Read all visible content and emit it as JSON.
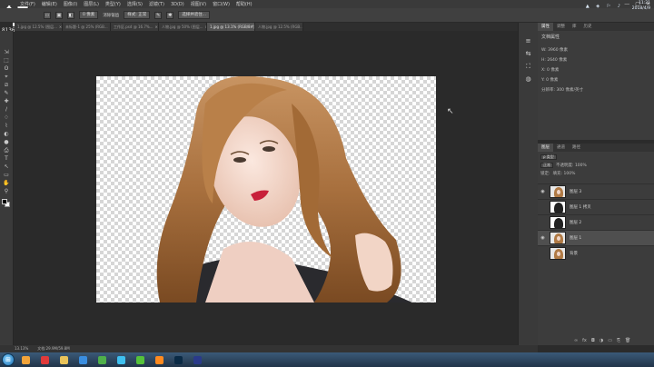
{
  "menu": [
    "文件(F)",
    "编辑(E)",
    "图像(I)",
    "图层(L)",
    "类型(Y)",
    "选择(S)",
    "滤镜(T)",
    "3D(D)",
    "视图(V)",
    "窗口(W)",
    "帮助(H)"
  ],
  "window_controls": [
    "—",
    "▢",
    "✕"
  ],
  "options": {
    "field1": "0 像素",
    "field2": "选择并遮住...",
    "check": "消除锯齿",
    "style": "样式: 正常"
  },
  "tabs": [
    {
      "label": "1.jpg @ 12.5% (图层...",
      "active": false
    },
    {
      "label": "未标题-1 @ 25% (RGB...",
      "active": false
    },
    {
      "label": "工作区.psd @ 16.7%...",
      "active": false
    },
    {
      "label": "人物.jpg @ 50% (图层...",
      "active": false
    },
    {
      "label": "1.jpg @ 13.1% (RGB/8#)",
      "active": true
    },
    {
      "label": "人物.jpg @ 12.5% (RGB...",
      "active": false
    }
  ],
  "watermark": {
    "logo": "今日",
    "sub": "头条号",
    "number": "8136828"
  },
  "tools": [
    "⇲",
    "⬚",
    "ʘ",
    "⌖",
    "⧄",
    "✎",
    "✚",
    "∕",
    "♢",
    "⌇",
    "◐",
    "●",
    "⎙",
    "T",
    "↖",
    "▭",
    "✋",
    "⚲"
  ],
  "dock_icons": [
    "≡",
    "⇆",
    "⛶",
    "◍"
  ],
  "properties": {
    "tabs": [
      "属性",
      "调整",
      "库",
      "历史"
    ],
    "title": "文档属性",
    "w": "W: 3960 像素",
    "h": "H: 2640 像素",
    "x": "X: 0 像素",
    "y": "Y: 0 像素",
    "res": "分辨率: 300 像素/英寸"
  },
  "layers_panel": {
    "tabs": [
      "图层",
      "通道",
      "路径"
    ],
    "kind": "ρ 类型",
    "mode": "正常",
    "opacity": "不透明度: 100%",
    "lock": "锁定:",
    "fill": "填充: 100%",
    "layers": [
      {
        "name": "图层 3",
        "visible": true,
        "selected": false,
        "mask": false
      },
      {
        "name": "图层 1 拷贝",
        "visible": false,
        "selected": false,
        "mask": true
      },
      {
        "name": "图层 2",
        "visible": false,
        "selected": false,
        "mask": true
      },
      {
        "name": "图层 1",
        "visible": true,
        "selected": true,
        "mask": false
      },
      {
        "name": "背景",
        "visible": false,
        "selected": false,
        "mask": false
      }
    ],
    "footer": [
      "∞",
      "fx",
      "◘",
      "◑",
      "▭",
      "⎘",
      "🗑"
    ]
  },
  "status": {
    "zoom": "13.13%",
    "doc": "文档:29.9M/59.8M"
  },
  "taskbar": {
    "apps": [
      {
        "name": "ie",
        "color": "#f2a43a"
      },
      {
        "name": "baidu",
        "color": "#e03a3a"
      },
      {
        "name": "folder",
        "color": "#e8c35a"
      },
      {
        "name": "media",
        "color": "#3a8ee0"
      },
      {
        "name": "chrome",
        "color": "#4fb04a"
      },
      {
        "name": "qq",
        "color": "#3ec0f0"
      },
      {
        "name": "360",
        "color": "#55c23a"
      },
      {
        "name": "ai",
        "color": "#ff8a1f"
      },
      {
        "name": "ps",
        "color": "#0a2a45"
      },
      {
        "name": "pr",
        "color": "#2a3a8a"
      }
    ],
    "time": "11:21",
    "date": "2018/4/9",
    "tray": "▲ ◈ ⚐ ♪"
  }
}
